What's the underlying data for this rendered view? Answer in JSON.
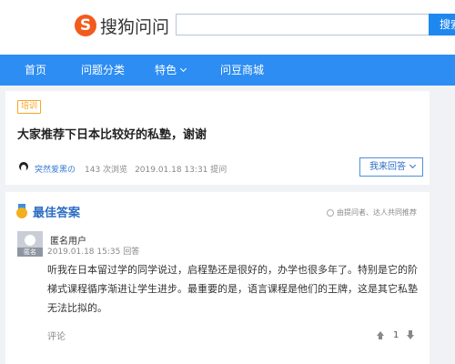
{
  "header": {
    "logo_badge": "S",
    "logo_text": "搜狗问问",
    "search_value": "",
    "search_button": "搜索"
  },
  "nav": {
    "items": [
      {
        "label": "首页"
      },
      {
        "label": "问题分类"
      },
      {
        "label": "特色"
      },
      {
        "label": "问豆商城"
      }
    ]
  },
  "question": {
    "tag": "培训",
    "title": "大家推荐下日本比较好的私塾，谢谢",
    "author": "突然爱黑の",
    "views": "143 次浏览",
    "time": "2019.01.18 13:31 提问",
    "answer_button": "我来回答"
  },
  "best_answer": {
    "heading": "最佳答案",
    "recommend_note": "由提问者、达人共同推荐",
    "avatar_label": "匿名",
    "user": "匿名用户",
    "time": "2019.01.18 15:35 回答",
    "lines": [
      "听我在日本留过学的同学说过，启程塾还是很好的，办学也很多年了。特别是它的阶",
      "梯式课程循序渐进让学生进步。最重要的是，语言课程是他们的王牌，这是其它私塾",
      "无法比拟的。"
    ],
    "comment_label": "评论",
    "vote_count": "1"
  },
  "colors": {
    "accent": "#2d8df3",
    "brand_orange": "#f35b1c",
    "tag": "#f5a623",
    "link": "#2d6dc4"
  }
}
